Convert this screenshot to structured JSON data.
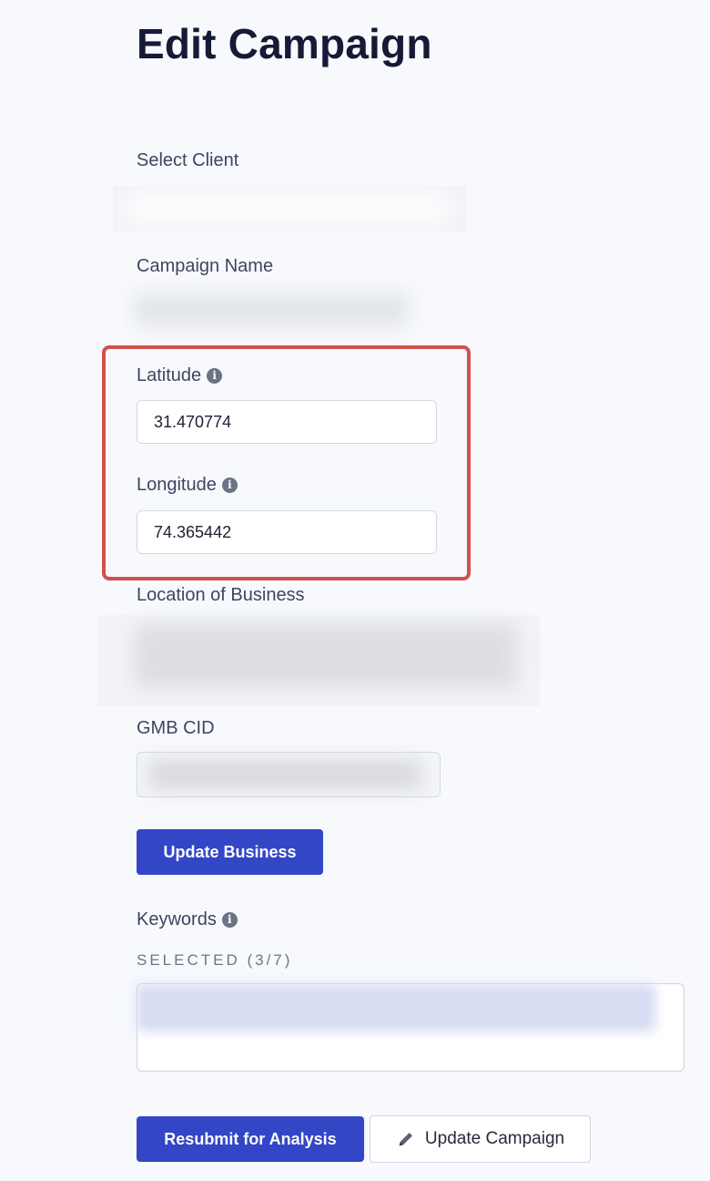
{
  "page": {
    "title": "Edit Campaign"
  },
  "fields": {
    "select_client": {
      "label": "Select Client"
    },
    "campaign_name": {
      "label": "Campaign Name"
    },
    "latitude": {
      "label": "Latitude",
      "value": "31.470774"
    },
    "longitude": {
      "label": "Longitude",
      "value": "74.365442"
    },
    "location": {
      "label": "Location of Business"
    },
    "gmb_cid": {
      "label": "GMB CID"
    }
  },
  "buttons": {
    "update_business": "Update Business",
    "resubmit": "Resubmit for Analysis",
    "update_campaign": "Update Campaign"
  },
  "keywords": {
    "label": "Keywords",
    "selected_caption": "SELECTED (3/7)"
  },
  "icons": {
    "info": "info-icon",
    "edit": "pencil-icon"
  },
  "colors": {
    "primary": "#3346c6",
    "highlight": "#d2504c"
  }
}
